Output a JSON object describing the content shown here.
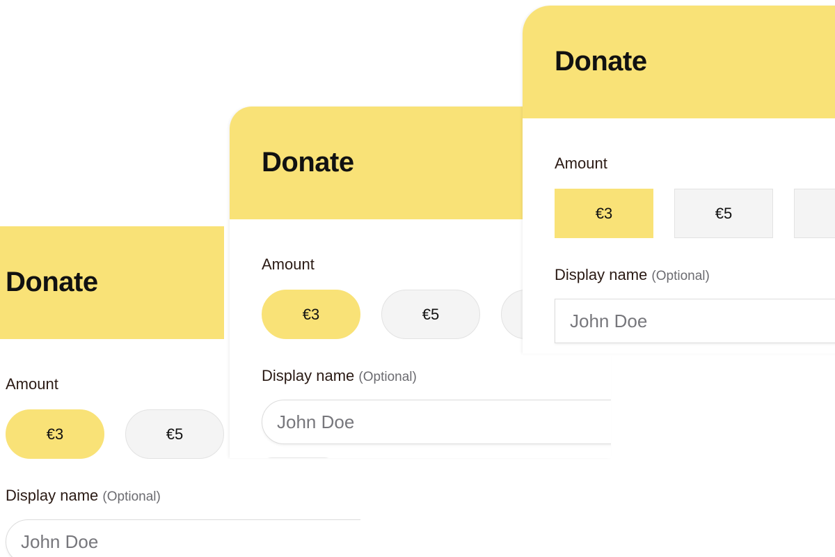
{
  "accent_color": "#f9e277",
  "cards": [
    {
      "title": "Donate",
      "amount_label": "Amount",
      "amounts": [
        "€3",
        "€5"
      ],
      "selected": "€3",
      "display_name_label": "Display name",
      "optional_label": "(Optional)",
      "name_placeholder": "John Doe",
      "style": "pill buttons, square header"
    },
    {
      "title": "Donate",
      "amount_label": "Amount",
      "amounts": [
        "€3",
        "€5"
      ],
      "selected": "€3",
      "display_name_label": "Display name",
      "optional_label": "(Optional)",
      "name_placeholder": "John Doe",
      "style": "pill buttons, rounded header"
    },
    {
      "title": "Donate",
      "amount_label": "Amount",
      "amounts": [
        "€3",
        "€5",
        "€"
      ],
      "selected": "€3",
      "display_name_label": "Display name",
      "optional_label": "(Optional)",
      "name_placeholder": "John Doe",
      "style": "square buttons, rounded header"
    }
  ]
}
